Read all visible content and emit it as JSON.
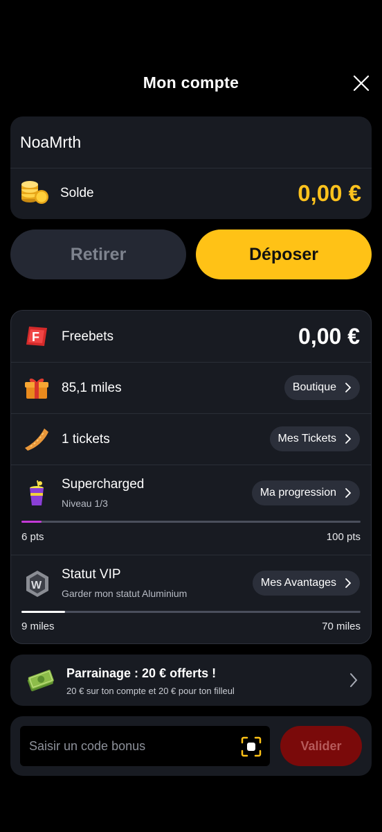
{
  "header": {
    "title": "Mon compte"
  },
  "account": {
    "username": "NoaMrth",
    "balance_label": "Solde",
    "balance_value": "0,00 €"
  },
  "actions": {
    "withdraw_label": "Retirer",
    "deposit_label": "Déposer"
  },
  "rewards": {
    "freebets": {
      "label": "Freebets",
      "value": "0,00 €"
    },
    "miles": {
      "label": "85,1 miles",
      "button": "Boutique"
    },
    "tickets": {
      "label": "1 tickets",
      "button": "Mes Tickets"
    },
    "supercharged": {
      "label": "Supercharged",
      "sublabel": "Niveau 1/3",
      "button": "Ma progression",
      "progress_fraction": 0.06,
      "min_label": "6 pts",
      "max_label": "100 pts"
    },
    "vip": {
      "label": "Statut VIP",
      "sublabel": "Garder mon statut Aluminium",
      "button": "Mes Avantages",
      "progress_fraction": 0.12857,
      "min_label": "9 miles",
      "max_label": "70 miles"
    }
  },
  "referral": {
    "title": "Parrainage : 20 € offerts !",
    "subtitle": "20 € sur ton compte et 20 € pour ton filleul"
  },
  "bonus": {
    "placeholder": "Saisir un code bonus",
    "submit_label": "Valider"
  },
  "colors": {
    "accent_yellow": "#ffc216",
    "balance_yellow": "#fdc21d",
    "card_bg": "#181b22",
    "supercharged_progress": "#c33ad6",
    "vip_progress": "#ffffff",
    "valider_bg": "#7a0a0a"
  },
  "icons": {
    "close": "close-icon",
    "coins": "coins-icon",
    "freebets": "freebets-f-icon",
    "gift": "gift-icon",
    "ticket": "ticket-icon",
    "drink": "drink-icon",
    "vip": "vip-badge-icon",
    "bills": "money-bills-icon",
    "scan": "scan-icon",
    "chevron": "chevron-right-icon"
  }
}
